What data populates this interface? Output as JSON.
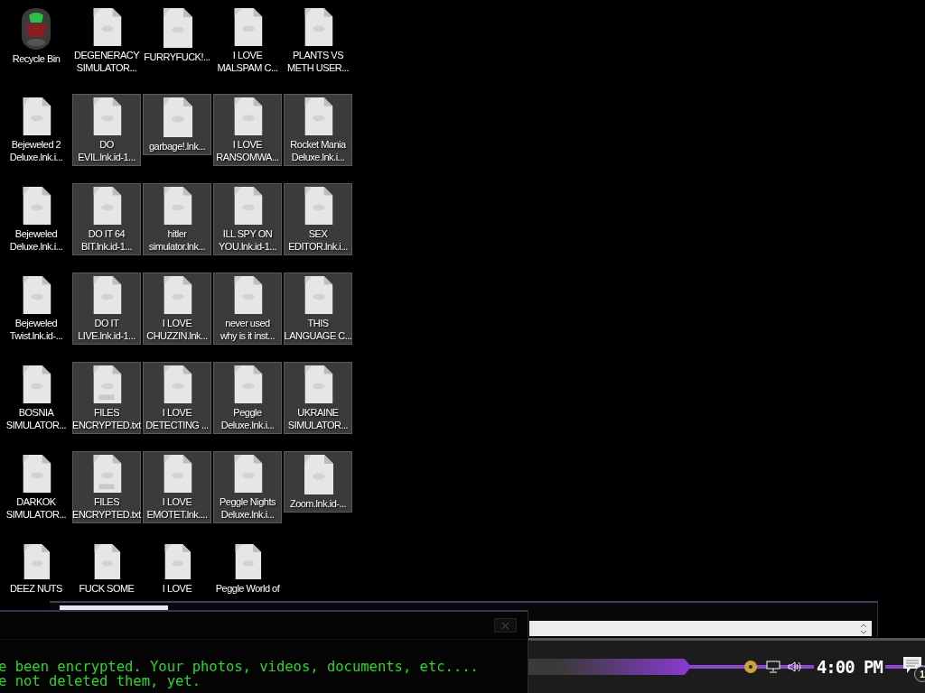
{
  "desktop": {
    "icons": [
      {
        "label": "Recycle Bin",
        "kind": "bin",
        "selected": false
      },
      {
        "label": "DEGENERACY\nSIMULATOR...",
        "kind": "file",
        "selected": false
      },
      {
        "label": "FURRYFUCK!...",
        "kind": "file",
        "selected": false
      },
      {
        "label": "I LOVE\nMALSPAM C...",
        "kind": "file",
        "selected": false
      },
      {
        "label": "PLANTS VS\nMETH USER...",
        "kind": "file",
        "selected": false
      },
      {
        "label": "Bejeweled 2\nDeluxe.lnk.i...",
        "kind": "file",
        "selected": false
      },
      {
        "label": "DO\nEVIL.lnk.id-1...",
        "kind": "file",
        "selected": true
      },
      {
        "label": "garbage!.lnk...",
        "kind": "file",
        "selected": true
      },
      {
        "label": "I LOVE\nRANSOMWA...",
        "kind": "file",
        "selected": true
      },
      {
        "label": "Rocket Mania\nDeluxe.lnk.i...",
        "kind": "file",
        "selected": true
      },
      {
        "label": "Bejeweled\nDeluxe.lnk.i...",
        "kind": "file",
        "selected": false
      },
      {
        "label": "DO IT 64\nBIT.lnk.id-1...",
        "kind": "file",
        "selected": true
      },
      {
        "label": "hitler\nsimulator.lnk...",
        "kind": "file",
        "selected": true
      },
      {
        "label": "ILL SPY ON\nYOU.lnk.id-1...",
        "kind": "file",
        "selected": true
      },
      {
        "label": "SEX\nEDITOR.lnk.i...",
        "kind": "file",
        "selected": true
      },
      {
        "label": "Bejeweled\nTwist.lnk.id-...",
        "kind": "file",
        "selected": false
      },
      {
        "label": "DO IT\nLIVE.lnk.id-1...",
        "kind": "file",
        "selected": true
      },
      {
        "label": "I LOVE\nCHUZZIN.lnk...",
        "kind": "file",
        "selected": true
      },
      {
        "label": "never used\nwhy is it inst...",
        "kind": "file",
        "selected": true
      },
      {
        "label": "THIS\nLANGUAGE C...",
        "kind": "file",
        "selected": true
      },
      {
        "label": "BOSNIA\nSIMULATOR...",
        "kind": "file",
        "selected": false
      },
      {
        "label": "FILES\nENCRYPTED.txt",
        "kind": "text",
        "selected": true
      },
      {
        "label": "I LOVE\nDETECTING ...",
        "kind": "file",
        "selected": true
      },
      {
        "label": "Peggle\nDeluxe.lnk.i...",
        "kind": "file",
        "selected": true
      },
      {
        "label": "UKRAINE\nSIMULATOR...",
        "kind": "file",
        "selected": true
      },
      {
        "label": "DARKOK\nSIMULATOR...",
        "kind": "file",
        "selected": false
      },
      {
        "label": "FILES\nENCRYPTED.txt",
        "kind": "text",
        "selected": true
      },
      {
        "label": "I LOVE\nEMOTET.lnk....",
        "kind": "file",
        "selected": true
      },
      {
        "label": "Peggle Nights\nDeluxe.lnk.i...",
        "kind": "file",
        "selected": true
      },
      {
        "label": "Zoom.lnk.id-...",
        "kind": "file",
        "selected": true
      },
      {
        "label": "DEEZ NUTS",
        "kind": "file",
        "selected": false
      },
      {
        "label": "FUCK SOME",
        "kind": "file",
        "selected": false
      },
      {
        "label": "I LOVE",
        "kind": "file",
        "selected": false
      },
      {
        "label": "Peggle World of",
        "kind": "file",
        "selected": false
      }
    ]
  },
  "terminal": {
    "lines": [
      "e been encrypted. Your photos, videos, documents, etc....",
      "e not deleted them, yet."
    ]
  },
  "taskbar": {
    "clock": "4:00 PM",
    "notification_count": "1"
  }
}
